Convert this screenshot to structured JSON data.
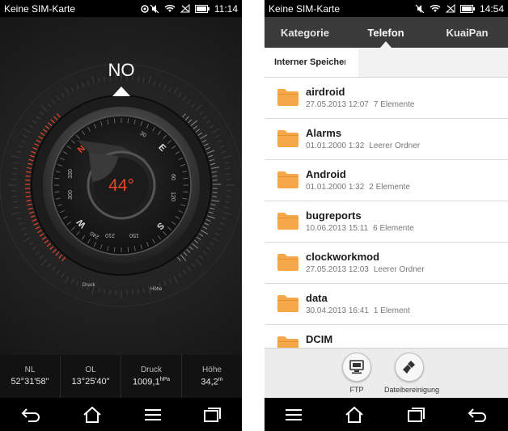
{
  "left_phone": {
    "status": {
      "carrier": "Keine SIM-Karte",
      "time": "11:14"
    },
    "compass": {
      "heading_label": "NO",
      "heading_degrees": "44°",
      "cardinals": {
        "n": "N",
        "e": "E",
        "s": "S",
        "w": "W"
      },
      "dial_numbers": [
        "30",
        "60",
        "120",
        "150",
        "210",
        "240",
        "300",
        "330"
      ],
      "pressure_gauge_label": "Druck",
      "altitude_gauge_label": "Höhe",
      "accent_color": "#e8452a"
    },
    "readouts": [
      {
        "label": "NL",
        "value": "52°31'58\"",
        "unit": ""
      },
      {
        "label": "OL",
        "value": "13°25'40\"",
        "unit": ""
      },
      {
        "label": "Druck",
        "value": "1009,1",
        "unit": "hPa"
      },
      {
        "label": "Höhe",
        "value": "34,2",
        "unit": "m"
      }
    ],
    "navbar": [
      "back-icon",
      "home-icon",
      "menu-icon",
      "recent-apps-icon"
    ]
  },
  "right_phone": {
    "status": {
      "carrier": "Keine SIM-Karte",
      "time": "14:54"
    },
    "tabs": [
      {
        "label": "Kategorie",
        "active": false
      },
      {
        "label": "Telefon",
        "active": true
      },
      {
        "label": "KuaiPan",
        "active": false
      }
    ],
    "breadcrumb": "Interner Speicher",
    "files": [
      {
        "name": "airdroid",
        "date": "27.05.2013 12:07",
        "count": "7 Elemente"
      },
      {
        "name": "Alarms",
        "date": "01.01.2000 1:32",
        "count": "Leerer Ordner"
      },
      {
        "name": "Android",
        "date": "01.01.2000 1:32",
        "count": "2 Elemente"
      },
      {
        "name": "bugreports",
        "date": "10.06.2013 15:11",
        "count": "6 Elemente"
      },
      {
        "name": "clockworkmod",
        "date": "27.05.2013 12:03",
        "count": "Leerer Ordner"
      },
      {
        "name": "data",
        "date": "30.04.2013 16:41",
        "count": "1 Element"
      },
      {
        "name": "DCIM",
        "date": "",
        "count": ""
      }
    ],
    "actions": [
      {
        "label": "FTP",
        "icon": "ftp-icon"
      },
      {
        "label": "Dateibereinigung",
        "icon": "cleanup-icon"
      }
    ],
    "folder_color": "#f5a84a",
    "navbar": [
      "menu-icon",
      "home-icon",
      "recent-apps-icon",
      "back-icon"
    ]
  }
}
